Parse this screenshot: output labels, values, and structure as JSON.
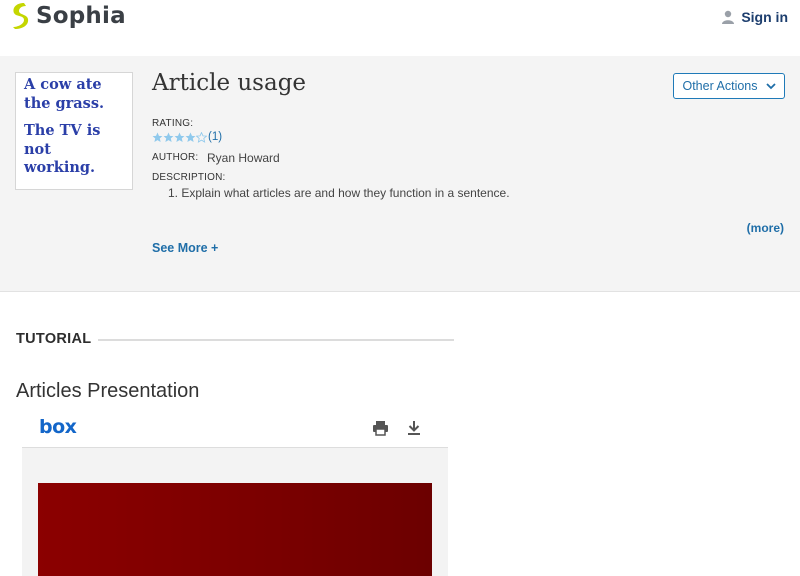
{
  "header": {
    "brand": "Sophia",
    "signin_label": "Sign in",
    "icons": {
      "logo": "sophia-logo-icon",
      "user": "user-icon"
    },
    "accent": "#c4d600"
  },
  "article": {
    "title": "Article usage",
    "thumbnail_text": [
      "A cow ate",
      "the grass.",
      "The TV is",
      "not",
      "working."
    ],
    "other_actions_label": "Other Actions",
    "rating_label": "RATING:",
    "rating_stars": 4,
    "rating_max": 5,
    "rating_count": "(1)",
    "author_label": "AUTHOR:",
    "author_name": "Ryan Howard",
    "description_label": "DESCRIPTION:",
    "description_items": [
      "1. Explain what articles are and how they function in a sentence."
    ],
    "more_label": "(more)",
    "see_more_label": "See More +"
  },
  "tutorial": {
    "label": "TUTORIAL",
    "section_title": "Articles Presentation",
    "viewer": {
      "brand": "box",
      "icons": [
        "print-icon",
        "download-icon"
      ],
      "slide_color": "#8b0000"
    }
  }
}
